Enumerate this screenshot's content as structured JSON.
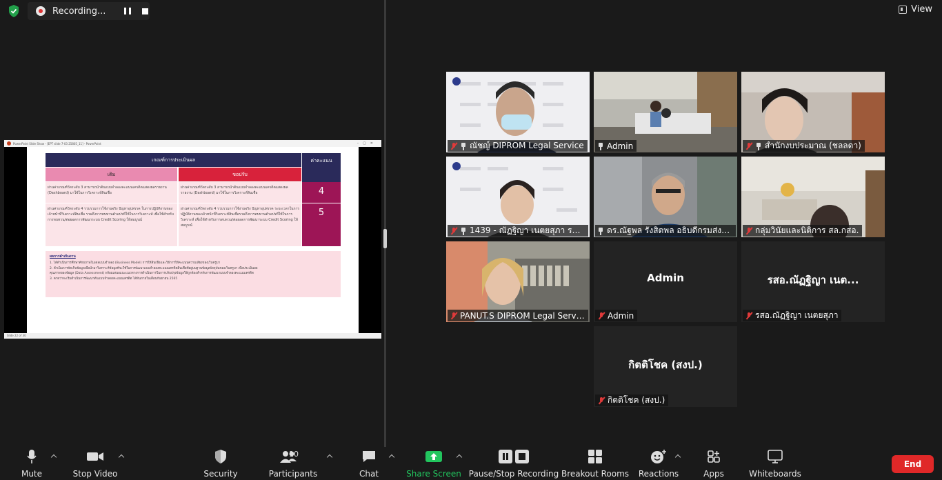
{
  "app": {
    "recording_label": "Recording...",
    "view_label": "View"
  },
  "shared_screen": {
    "window_title": "PowerPoint Slide Show - [EPT slide 7-03 25805_11] - PowerPoint",
    "status_left": "Slide 22 of 30",
    "slide": {
      "table_title": "เกณฑ์การประเมินผล",
      "score_header": "ค่าคะแนน",
      "col_old": "เดิม",
      "col_new": "ขอปรับ",
      "rows": [
        {
          "old": "ผ่านค่าเกณฑ์วัดระดับ 3 สามารถนำต้นแบบจำลองคะแนนเครดิตแสดงผลรายงาน (Dashboard) มาใช้ในการวิเคราะห์สินเชื่อ",
          "new": "ผ่านค่าเกณฑ์วัดระดับ 3 สามารถนำต้นแบบจำลองคะแนนเครดิตแสดงผลรายงาน (Dashboard) มาใช้ในการวิเคราะห์สินเชื่อ",
          "score": "4"
        },
        {
          "old": "ผ่านค่าเกณฑ์วัดระดับ 4 รวบรวมการใช้งานจริง ปัญหาอุปสรรค ในการปฏิบัติงานของเจ้าหน้าที่วิเคราะห์สินเชื่อ รวมถึงการทบทวนตัวแปรที่ใช้ในการวิเคราะห์ เพื่อใช้สำหรับการทบทวน/ต่อยอดการพัฒนาระบบ Credit Scoring ให้สมบูรณ์",
          "new": "ผ่านค่าเกณฑ์วัดระดับ 4 รวบรวมการใช้งานจริง ปัญหาอุปสรรค ระยะเวลาในการปฏิบัติงานของเจ้าหน้าที่วิเคราะห์สินเชื่อรวมถึงการทบทวนตัวแปรที่ใช้ในการวิเคราะห์ เพื่อใช้สำหรับการทบทวน/ต่อยอดการพัฒนาระบบ Credit Scoring ให้สมบูรณ์",
          "score": "5"
        }
      ],
      "result_title": "ผลการดำเนินงาน",
      "result_lines": [
        "1. ได้ดำเนินการศึกษาศักยภาพโมเดลแบบจำลอง (Business Model) การให้สินเชื่อและวิธีการให้คะแนนความเสี่ยงของเว็บครูบา",
        "2. ดำเนินการจัดเก็บข้อมูลเพื่อนำมาวิเคราะห์ข้อมูลที่จะใช้ในการพัฒนาแบบจำลองคะแนนเครดิตสินเชื่อที่อยู่บนฐานข้อมูลปัจจุบันของเว็บครูบา เพื่อประเมินผล",
        "คุณภาพของข้อมูล (Data Assessment) พร้อมเสนอแนะแนวทางการดำเนินการในการปรับปรุงข้อมูลให้ถูกต้องสำหรับการพัฒนาแบบจำลองคะแนนเครดิต",
        "3. คาดว่าจะเริ่มดำเนินการพัฒนาต้นแบบจำลองคะแนนเครดิต ได้ทันภายในเดือนกันยายน 2565"
      ]
    }
  },
  "participants": [
    {
      "name": "ณัชญ์ DIPROM Legal Service",
      "muted": true,
      "pinned": true,
      "video": true
    },
    {
      "name": "Admin",
      "muted": false,
      "pinned": true,
      "video": true
    },
    {
      "name": "สำนักงบประมาณ (ชลลดา)",
      "muted": true,
      "pinned": true,
      "video": true
    },
    {
      "name": "1439 - ณัฏฐิญา เนตยสุภา รอง...",
      "muted": true,
      "pinned": true,
      "video": true
    },
    {
      "name": "ดร.ณัฐพล รังสิตพล อธิบดีกรมส่งเส...",
      "muted": false,
      "pinned": true,
      "video": true,
      "active": true
    },
    {
      "name": "กลุ่มวินัยและนิติการ สล.กสอ.",
      "muted": true,
      "pinned": false,
      "video": true
    },
    {
      "name": "PANUT.S DIPROM Legal Service",
      "muted": true,
      "pinned": false,
      "video": true
    },
    {
      "name": "Admin",
      "muted": true,
      "pinned": false,
      "video": false,
      "display_name": "Admin"
    },
    {
      "name": "รสอ.ณัฏฐิญา เนตยสุภา",
      "muted": true,
      "pinned": false,
      "video": false,
      "display_name": "รสอ.ณัฏฐิญา เนต..."
    },
    {
      "name": "กิตติโชค (สงป.)",
      "muted": true,
      "pinned": false,
      "video": false,
      "display_name": "กิตติโชค (สงป.)"
    }
  ],
  "toolbar": {
    "mute": "Mute",
    "stop_video": "Stop Video",
    "security": "Security",
    "participants": "Participants",
    "participants_count": "10",
    "chat": "Chat",
    "share_screen": "Share Screen",
    "pause_stop_recording": "Pause/Stop Recording",
    "breakout_rooms": "Breakout Rooms",
    "reactions": "Reactions",
    "apps": "Apps",
    "whiteboards": "Whiteboards",
    "end": "End"
  },
  "colors": {
    "accent_green": "#22c55e",
    "end_red": "#e02828",
    "active_speaker": "#c8e35b",
    "muted_red": "#e03a3a"
  }
}
